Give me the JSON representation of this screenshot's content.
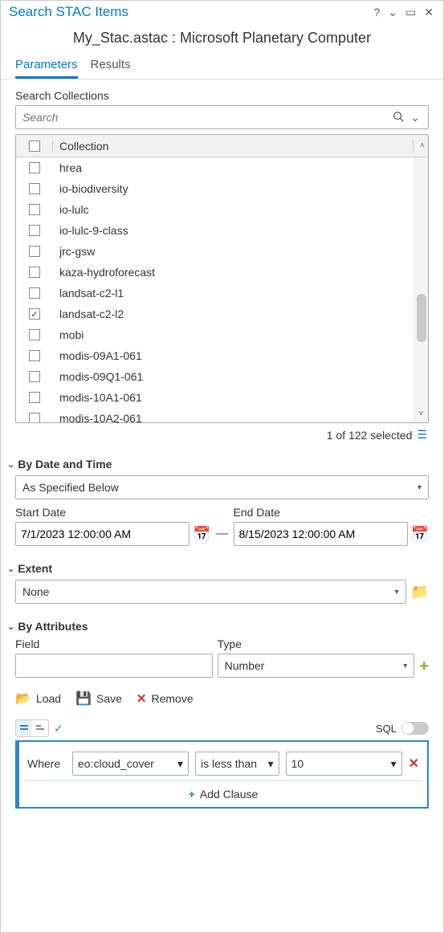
{
  "window": {
    "title": "Search STAC Items",
    "subtitle": "My_Stac.astac : Microsoft Planetary Computer"
  },
  "tabs": [
    {
      "label": "Parameters",
      "active": true
    },
    {
      "label": "Results",
      "active": false
    }
  ],
  "searchCollections": {
    "label": "Search Collections",
    "placeholder": "Search",
    "header": "Collection",
    "rows": [
      {
        "name": "hrea",
        "checked": false
      },
      {
        "name": "io-biodiversity",
        "checked": false
      },
      {
        "name": "io-lulc",
        "checked": false
      },
      {
        "name": "io-lulc-9-class",
        "checked": false
      },
      {
        "name": "jrc-gsw",
        "checked": false
      },
      {
        "name": "kaza-hydroforecast",
        "checked": false
      },
      {
        "name": "landsat-c2-l1",
        "checked": false
      },
      {
        "name": "landsat-c2-l2",
        "checked": true
      },
      {
        "name": "mobi",
        "checked": false
      },
      {
        "name": "modis-09A1-061",
        "checked": false
      },
      {
        "name": "modis-09Q1-061",
        "checked": false
      },
      {
        "name": "modis-10A1-061",
        "checked": false
      },
      {
        "name": "modis-10A2-061",
        "checked": false
      }
    ],
    "selectedText": "1 of 122 selected"
  },
  "byDateTime": {
    "header": "By Date and Time",
    "mode": "As Specified Below",
    "startLabel": "Start Date",
    "endLabel": "End Date",
    "start": "7/1/2023 12:00:00 AM",
    "end": "8/15/2023 12:00:00 AM"
  },
  "extent": {
    "header": "Extent",
    "value": "None"
  },
  "byAttributes": {
    "header": "By Attributes",
    "fieldLabel": "Field",
    "typeLabel": "Type",
    "typeValue": "Number",
    "actions": {
      "load": "Load",
      "save": "Save",
      "remove": "Remove"
    },
    "sqlLabel": "SQL",
    "clause": {
      "keyword": "Where",
      "field": "eo:cloud_cover",
      "operator": "is less than",
      "value": "10"
    },
    "addClause": "Add Clause"
  }
}
